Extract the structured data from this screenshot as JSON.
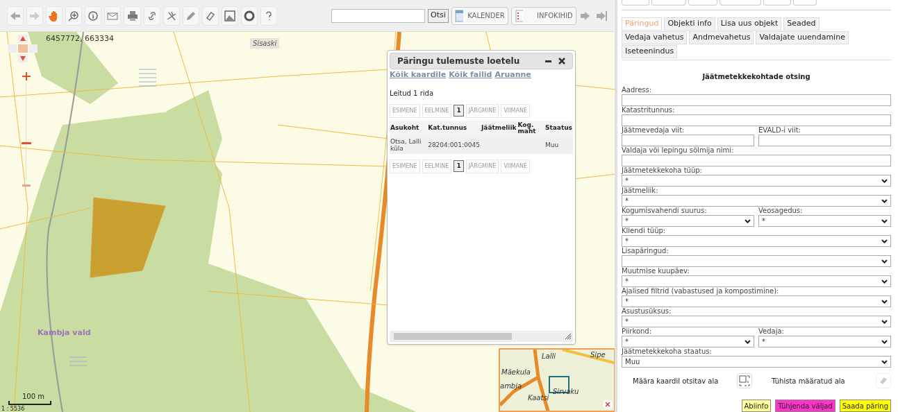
{
  "toolbar": {
    "search_button": "Otsi",
    "calendar_button": "KALENDER",
    "info_button": "INFOKIHID"
  },
  "map": {
    "zoom": {
      "level": 0.38
    },
    "coordinates": "6457772, 663334",
    "labels": [
      {
        "text": "Sisaski",
        "kind": "place"
      },
      {
        "text": "Kambja vald",
        "kind": "parish"
      }
    ],
    "scale_bar": "100 m",
    "scale": "1 : 5536"
  },
  "results_window": {
    "title": "Päringu tulemuste loetelu",
    "links": [
      "Kõik kaardile",
      "Kõik failid",
      "Aruanne"
    ],
    "found": "Leitud 1 rida",
    "pager_top": [
      {
        "label": "ESIMENE",
        "selected": false
      },
      {
        "label": "EELMINE",
        "selected": false
      },
      {
        "label": "1",
        "selected": true
      },
      {
        "label": "JÄRGMINE",
        "selected": false
      },
      {
        "label": "VIIMANE",
        "selected": false
      }
    ],
    "pager_bottom": [
      {
        "label": "ESIMENE",
        "selected": false
      },
      {
        "label": "EELMINE",
        "selected": false
      },
      {
        "label": "1",
        "selected": true
      },
      {
        "label": "JÄRGMINE",
        "selected": false
      },
      {
        "label": "VIIMANE",
        "selected": false
      }
    ],
    "columns": [
      "Asukoht",
      "Kat.tunnus",
      "Jäätmeliik",
      "Kog. maht",
      "Staatus"
    ],
    "rows": [
      [
        "Otsa, Lalli küla",
        "28204:001:0045",
        "",
        "",
        "Muu"
      ]
    ]
  },
  "overview_map": {
    "labels": [
      "Lalli",
      "Sipe",
      "Mäekula",
      "ambja",
      "Sirvaku",
      "Kaatsi"
    ]
  },
  "tabs": [
    {
      "label": "Päringud",
      "selected": true
    },
    {
      "label": "Objekti info",
      "selected": false
    },
    {
      "label": "Lisa uus objekt",
      "selected": false
    },
    {
      "label": "Seaded",
      "selected": false
    },
    {
      "label": "Vedaja vahetus",
      "selected": false
    },
    {
      "label": "Andmevahetus",
      "selected": false
    },
    {
      "label": "Valdajate uuendamine",
      "selected": false
    },
    {
      "label": "Iseteenindus",
      "selected": false
    }
  ],
  "form": {
    "title": "Jäätmetekkekohtade otsing",
    "rows": [
      [
        {
          "label": "Aadress:",
          "kind": "text"
        }
      ],
      [
        {
          "label": "Katastritunnus:",
          "kind": "text"
        }
      ],
      [
        {
          "label": "Jäätmevedaja viit:",
          "kind": "text"
        },
        {
          "label": "EVALD-i viit:",
          "kind": "text"
        }
      ],
      [
        {
          "label": "Valdaja või lepingu sõlmija nimi:",
          "kind": "text"
        }
      ],
      [
        {
          "label": "Jäätmetekkekoha tüüp:",
          "kind": "select",
          "value": "*"
        }
      ],
      [
        {
          "label": "Jäätmeliik:",
          "kind": "select",
          "value": "*"
        }
      ],
      [
        {
          "label": "Kogumisvahendi suurus:",
          "kind": "select",
          "value": "*"
        },
        {
          "label": "Veosagedus:",
          "kind": "select",
          "value": "*"
        }
      ],
      [
        {
          "label": "Kliendi tüüp:",
          "kind": "select",
          "value": "*"
        }
      ],
      [
        {
          "label": "Lisapäringud:",
          "kind": "select"
        }
      ],
      [
        {
          "label": "Muutmise kuupäev:",
          "kind": "select",
          "value": "*"
        }
      ],
      [
        {
          "label": "Ajalised filtrid (vabastused ja kompostimine):",
          "kind": "select",
          "value": "*"
        }
      ],
      [
        {
          "label": "Asustusüksus:",
          "kind": "select",
          "value": "*"
        }
      ],
      [
        {
          "label": "Piirkond:",
          "kind": "select",
          "value": "*"
        },
        {
          "label": "Vedaja:",
          "kind": "select",
          "value": "*"
        }
      ],
      [
        {
          "label": "Jäätmetekkekoha staatus:",
          "kind": "select",
          "value": "Muu"
        }
      ]
    ],
    "area_set": "Määra kaardil otsitav ala",
    "area_clear": "Tühista määratud ala",
    "buttons": [
      {
        "label": "Abiinfo",
        "color": "#ffff99"
      },
      {
        "label": "Tühjenda väljad",
        "color": "#ff33cc"
      },
      {
        "label": "Saada päring",
        "color": "#ffff00"
      }
    ]
  }
}
